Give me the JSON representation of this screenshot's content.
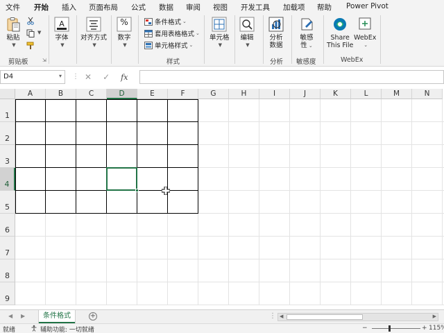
{
  "menu": {
    "tabs": [
      "文件",
      "开始",
      "插入",
      "页面布局",
      "公式",
      "数据",
      "审阅",
      "视图",
      "开发工具",
      "加载项",
      "帮助",
      "Power Pivot"
    ],
    "active": "开始"
  },
  "ribbon": {
    "clipboard": {
      "paste_label": "粘贴",
      "group_label": "剪贴板"
    },
    "font": {
      "label": "字体"
    },
    "alignment": {
      "label": "对齐方式"
    },
    "number": {
      "label": "数字",
      "symbol": "%"
    },
    "styles": {
      "conditional_format": "条件格式",
      "table_format": "套用表格格式",
      "cell_style": "单元格样式",
      "group_label": "样式"
    },
    "cells": {
      "label": "单元格"
    },
    "editing": {
      "label": "编辑"
    },
    "analysis": {
      "label_line1": "分析",
      "label_line2": "数据",
      "group_label": "分析"
    },
    "sensitivity": {
      "label_line1": "敏感",
      "label_line2": "性",
      "group_label": "敏感度"
    },
    "webex": {
      "share_line1": "Share",
      "share_line2": "This File",
      "webex_label": "WebEx",
      "group_label": "WebEx"
    },
    "colors": {
      "accent": "#217346",
      "webex_blue": "#0a7ab3"
    }
  },
  "formula_bar": {
    "name_box": "D4",
    "cancel_symbol": "✕",
    "enter_symbol": "✓",
    "fx_symbol": "fx",
    "formula_value": ""
  },
  "grid": {
    "columns": [
      "A",
      "B",
      "C",
      "D",
      "E",
      "F",
      "G",
      "H",
      "I",
      "J",
      "K",
      "L",
      "M",
      "N"
    ],
    "rows": [
      "1",
      "2",
      "3",
      "4",
      "5",
      "6",
      "7",
      "8",
      "9"
    ],
    "selected_cell": "D4",
    "bordered_range": "A1:F5"
  },
  "sheets": {
    "tabs": [
      "条件格式"
    ],
    "active": "条件格式",
    "add_symbol": "+"
  },
  "status": {
    "ready": "就绪",
    "accessibility": "辅助功能: 一切就绪",
    "zoom_minus": "−",
    "zoom_plus": "+",
    "zoom_level": "115%"
  }
}
